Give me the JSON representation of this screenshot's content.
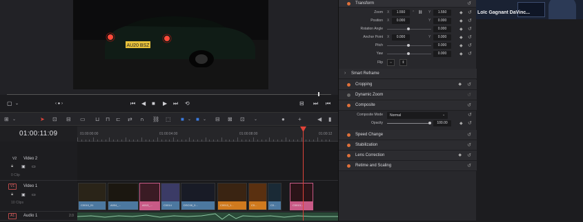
{
  "viewer": {
    "car_plate": "AU20 BSZ",
    "controls": {
      "left_icons": [
        "viewer-mode-icon",
        "chevron-down-icon",
        "dot-menu-icon"
      ],
      "transport": [
        "skip-to-start-icon",
        "step-back-icon",
        "stop-icon",
        "play-icon",
        "skip-to-end-icon",
        "loop-icon"
      ],
      "right_icons": [
        "match-frame-icon",
        "prev-frame-icon",
        "next-frame-icon"
      ]
    }
  },
  "timeline": {
    "timecode": "01:00:11:09",
    "ruler": [
      "01:00:00:00",
      "01:00:04:00",
      "01:00:08:00",
      "01:00:12"
    ],
    "tracks": {
      "v2": {
        "badge": "V2",
        "name": "Video 2",
        "clip_count": "0 Clip"
      },
      "v1": {
        "badge": "V1",
        "name": "Video 1",
        "clip_count": "10 Clips"
      },
      "a1": {
        "badge": "A1",
        "name": "Audio 1",
        "level": "2.0"
      }
    },
    "clips": [
      {
        "label": "C0010_01",
        "cap_color": "#4c78a0",
        "thumb": "#2a2418"
      },
      {
        "label": "A004_...",
        "cap_color": "#4c78a0",
        "thumb": "#1b1710"
      },
      {
        "label": "A013_...",
        "cap_color": "#c85a86",
        "thumb": "#3a1b24"
      },
      {
        "label": "C0014",
        "cap_color": "#4c78a0",
        "thumb": "#3b3b66"
      },
      {
        "label": "DSC08_0...",
        "cap_color": "#4c78a0",
        "thumb": "#181b26"
      },
      {
        "label": "C0013_1...",
        "cap_color": "#d07a1e",
        "thumb": "#3a2412"
      },
      {
        "label": "C0...",
        "cap_color": "#d07a1e",
        "thumb": "#5a3010"
      },
      {
        "label": "C0...",
        "cap_color": "#4c78a0",
        "thumb": "#1a2a36"
      },
      {
        "label": "C0013...",
        "cap_color": "#c85a86",
        "thumb": "#2a1418"
      }
    ]
  },
  "inspector": {
    "transform": {
      "title": "Transform",
      "zoom": {
        "label": "Zoom",
        "x": "1.550",
        "y": "1.550"
      },
      "position": {
        "label": "Position",
        "x": "0.000",
        "y": "0.000"
      },
      "rotation": {
        "label": "Rotation Angle",
        "value": "0.000"
      },
      "anchor": {
        "label": "Anchor Point",
        "x": "0.000",
        "y": "0.000"
      },
      "pitch": {
        "label": "Pitch",
        "value": "0.000"
      },
      "yaw": {
        "label": "Yaw",
        "value": "0.000"
      },
      "flip": {
        "label": "Flip"
      }
    },
    "smart_reframe": "Smart Reframe",
    "cropping": "Cropping",
    "dynamic_zoom": "Dynamic Zoom",
    "composite": {
      "title": "Composite",
      "mode_label": "Composite Mode",
      "mode_value": "Normal",
      "opacity_label": "Opacity",
      "opacity_value": "100.00"
    },
    "speed_change": "Speed Change",
    "stabilization": "Stabilization",
    "lens_correction": "Lens Correction",
    "retime": "Retime and Scaling"
  },
  "webcam": {
    "name": "Loïc Gagnant DaVinc..."
  }
}
